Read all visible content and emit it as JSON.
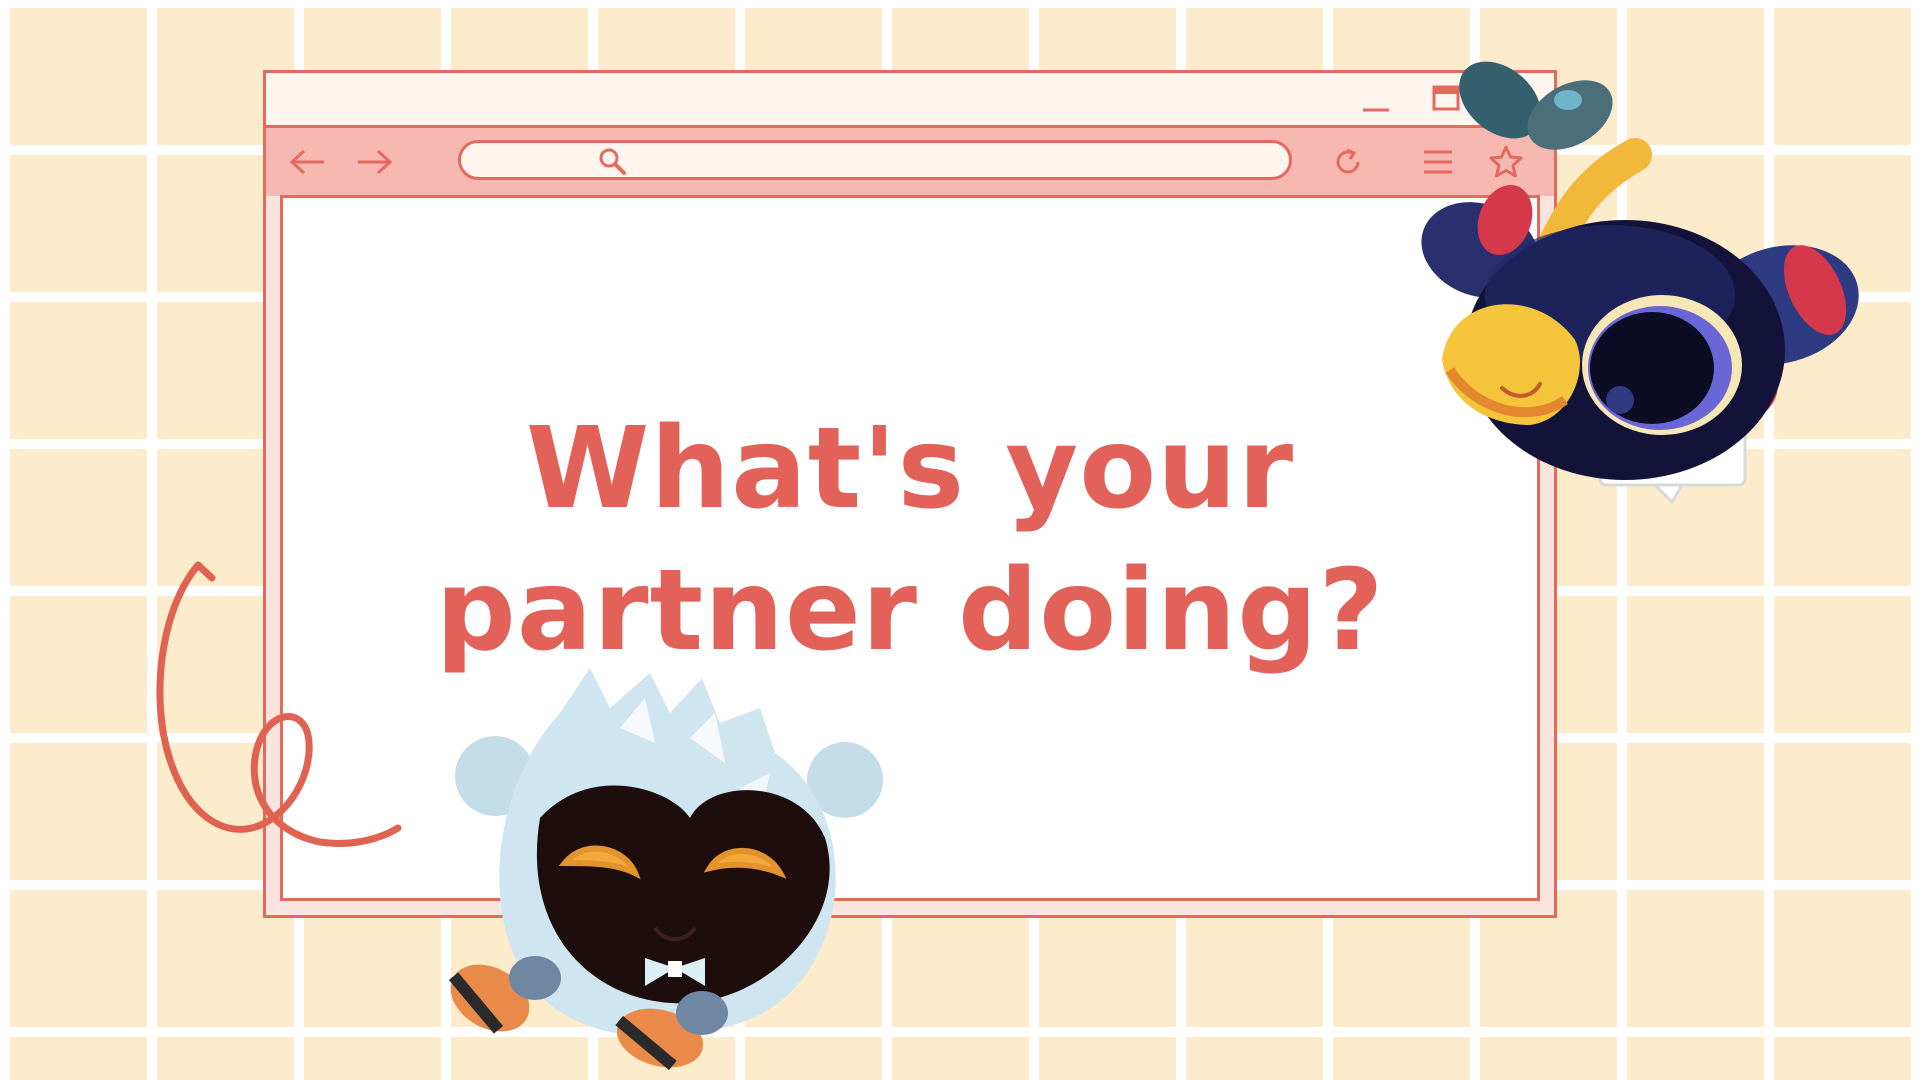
{
  "page": {
    "headline_line1": "What's your",
    "headline_line2": "partner doing?"
  },
  "browser": {
    "url_value": "",
    "icons": {
      "minimize": "minimize-icon",
      "maximize": "maximize-icon",
      "close": "close-icon",
      "back": "arrow-left-icon",
      "forward": "arrow-right-icon",
      "search": "search-icon",
      "reload": "reload-icon",
      "menu": "menu-icon",
      "favorite": "star-icon"
    }
  },
  "colors": {
    "background": "#fdeccb",
    "grid": "#ffffff",
    "accent": "#e36a5f",
    "toolbar": "#f6b8b0",
    "headline": "#e2625a"
  }
}
